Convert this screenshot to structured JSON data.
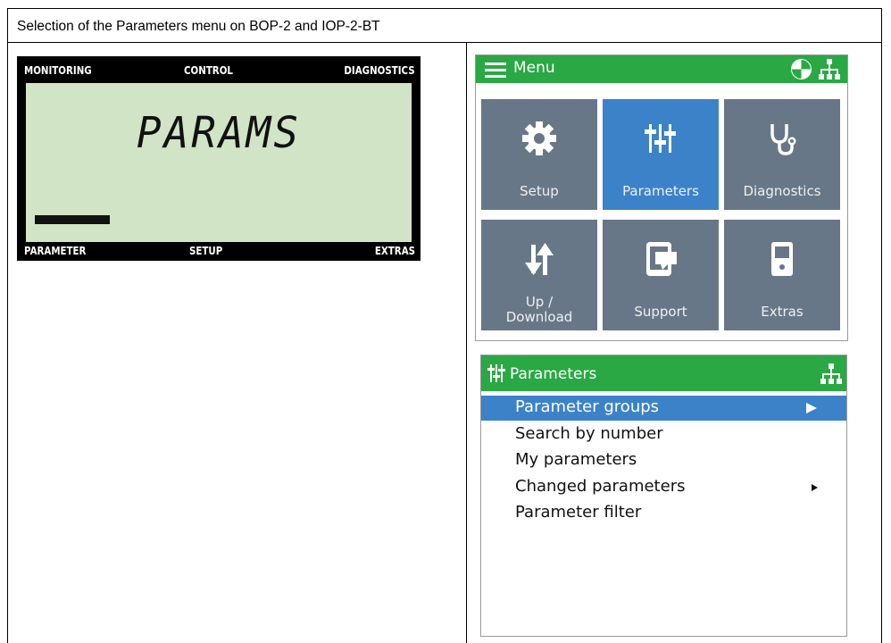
{
  "caption": "Selection of the Parameters menu on BOP-2 and IOP-2-BT",
  "bop": {
    "top_labels": [
      "MONITORING",
      "CONTROL",
      "DIAGNOSTICS"
    ],
    "display": "PARAMS",
    "bottom_labels": [
      "PARAMETER",
      "SETUP",
      "EXTRAS"
    ]
  },
  "iop_menu": {
    "title": "Menu",
    "tiles": [
      {
        "label": "Setup",
        "icon": "gear-icon"
      },
      {
        "label": "Parameters",
        "icon": "sliders-icon",
        "selected": true
      },
      {
        "label": "Diagnostics",
        "icon": "stethoscope-icon"
      },
      {
        "label": "Up / Download",
        "icon": "updown-icon"
      },
      {
        "label": "Support",
        "icon": "support-icon"
      },
      {
        "label": "Extras",
        "icon": "device-icon"
      }
    ]
  },
  "iop_params": {
    "title": "Parameters",
    "items": [
      {
        "label": "Parameter groups",
        "selected": true,
        "submenu": true
      },
      {
        "label": "Search by number"
      },
      {
        "label": "My parameters"
      },
      {
        "label": "Changed parameters",
        "submenu": true
      },
      {
        "label": "Parameter filter"
      }
    ]
  },
  "colors": {
    "green": "#29a844",
    "tile": "#687787",
    "selected": "#3c82c8",
    "lcd": "#d2e4c6"
  }
}
